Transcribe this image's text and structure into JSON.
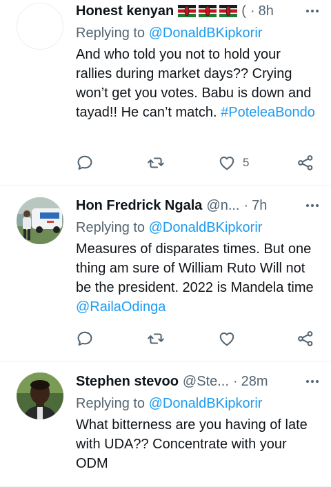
{
  "colors": {
    "link": "#1d9bf0",
    "muted": "#536471",
    "text": "#0f1419",
    "divider": "#eff3f4"
  },
  "tweets": [
    {
      "name": "Honest kenyan",
      "flags": [
        "kenya-flag",
        "kenya-flag",
        "kenya-flag"
      ],
      "handle": "(",
      "dot": "·",
      "time": "8h",
      "replying_prefix": "Replying to",
      "replying_to": "@DonaldBKipkorir",
      "text_parts": {
        "p1": "And who told you not to hold your rallies during market days?? Crying won’t get you votes. Babu is down and tayad!! He can’t match.",
        "link": "#PoteleaBondo"
      },
      "likes": "5"
    },
    {
      "name": "Hon Fredrick Ngala",
      "handle": "@n...",
      "dot": "·",
      "time": "7h",
      "replying_prefix": "Replying to",
      "replying_to": "@DonaldBKipkorir",
      "text_parts": {
        "p1": "Measures of disparates times. But one thing am sure of William Ruto Will not be the president. 2022 is Mandela time",
        "link": "@RailaOdinga"
      },
      "likes": ""
    },
    {
      "name": "Stephen stevoo",
      "handle": "@Ste...",
      "dot": "·",
      "time": "28m",
      "replying_prefix": "Replying to",
      "replying_to": "@DonaldBKipkorir",
      "text_parts": {
        "p1": "What bitterness are you having of late with UDA?? Concentrate with your ODM"
      }
    }
  ]
}
